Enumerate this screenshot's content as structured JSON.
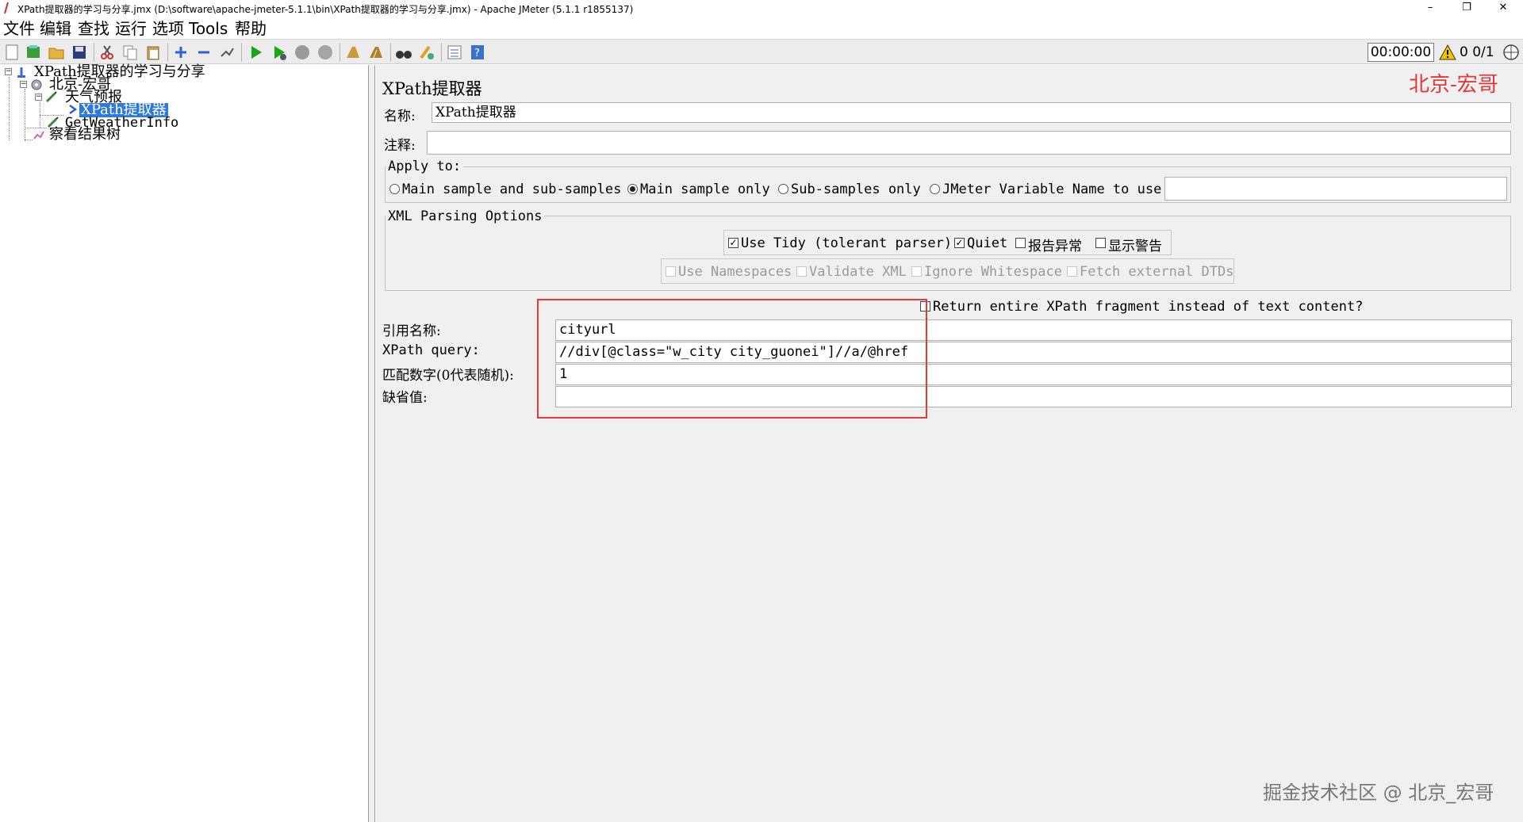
{
  "window": {
    "title": "XPath提取器的学习与分享.jmx (D:\\software\\apache-jmeter-5.1.1\\bin\\XPath提取器的学习与分享.jmx) - Apache JMeter (5.1.1 r1855137)",
    "minimize": "–",
    "restore": "❐",
    "close": "✕"
  },
  "menu": [
    "文件",
    "编辑",
    "查找",
    "运行",
    "选项",
    "Tools",
    "帮助"
  ],
  "toolbar": {
    "timer": "00:00:00",
    "counts": "0 0/1"
  },
  "tree": {
    "root": "XPath提取器的学习与分享",
    "thread_group": "北京-宏哥",
    "sampler": "天气预报",
    "selected_extractor": "XPath提取器",
    "sampler2": "GetWeatherInfo",
    "listener": "察看结果树"
  },
  "panel": {
    "title": "XPath提取器",
    "watermark_top": "北京-宏哥",
    "name_label": "名称:",
    "name_value": "XPath提取器",
    "comment_label": "注释:",
    "comment_value": "",
    "apply_to": {
      "legend": "Apply to:",
      "options": [
        "Main sample and sub-samples",
        "Main sample only",
        "Sub-samples only",
        "JMeter Variable Name to use"
      ],
      "selected": "Main sample only",
      "variable_value": ""
    },
    "xml_options": {
      "legend": "XML Parsing Options",
      "use_tidy": "Use Tidy (tolerant parser)",
      "quiet": "Quiet",
      "report_errors": "报告异常",
      "show_warnings": "显示警告",
      "use_namespaces": "Use Namespaces",
      "validate_xml": "Validate XML",
      "ignore_whitespace": "Ignore Whitespace",
      "fetch_dtds": "Fetch external DTDs"
    },
    "return_fragment": "Return entire XPath fragment instead of text content?",
    "ref_name_label": "引用名称:",
    "ref_name_value": "cityurl",
    "xpath_label": "XPath query:",
    "xpath_value": "//div[@class=\"w_city city_guonei\"]//a/@href",
    "match_label": "匹配数字(0代表随机):",
    "match_value": "1",
    "default_label": "缺省值:",
    "default_value": ""
  },
  "watermark_bottom": "掘金技术社区 @ 北京_宏哥",
  "colors": {
    "accent_red": "#e33b3b",
    "selection_blue": "#2f7ad8"
  }
}
